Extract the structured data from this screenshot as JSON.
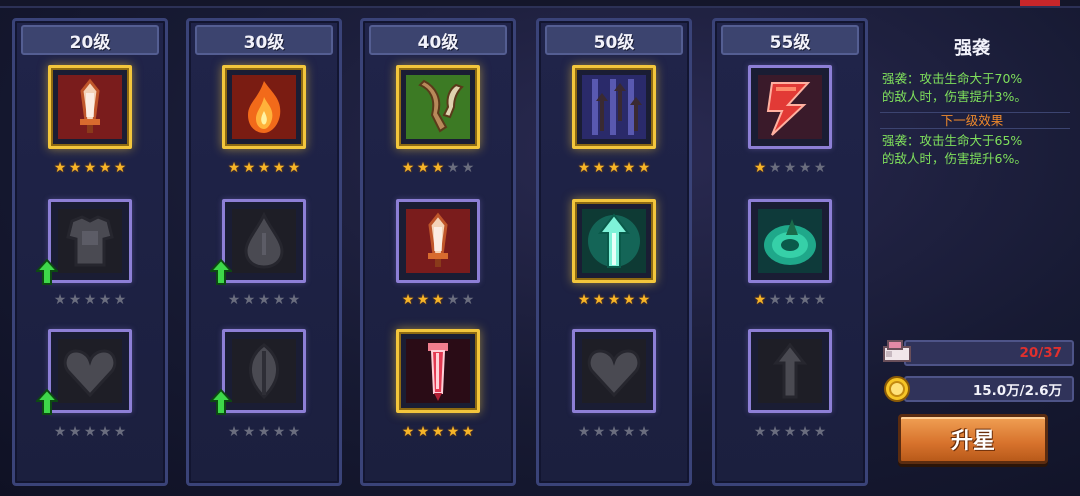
{
  "columns": [
    {
      "level": "20级",
      "slots": [
        {
          "icon": "sword-icon",
          "frame": "gold",
          "stars": 5,
          "upgrade": false
        },
        {
          "icon": "armor-icon",
          "frame": "purple",
          "stars": 0,
          "upgrade": true
        },
        {
          "icon": "heart-icon",
          "frame": "purple",
          "stars": 0,
          "upgrade": true
        }
      ]
    },
    {
      "level": "30级",
      "slots": [
        {
          "icon": "fire-icon",
          "frame": "gold",
          "stars": 5,
          "upgrade": false
        },
        {
          "icon": "drop-icon",
          "frame": "purple",
          "stars": 0,
          "upgrade": true
        },
        {
          "icon": "leaf-icon",
          "frame": "purple",
          "stars": 0,
          "upgrade": true
        }
      ]
    },
    {
      "level": "40级",
      "slots": [
        {
          "icon": "horn-icon",
          "frame": "gold",
          "stars": 3,
          "upgrade": false
        },
        {
          "icon": "sword-icon",
          "frame": "purple",
          "stars": 3,
          "upgrade": false
        },
        {
          "icon": "crystal-sword-icon",
          "frame": "gold",
          "stars": 5,
          "upgrade": false
        }
      ]
    },
    {
      "level": "50级",
      "slots": [
        {
          "icon": "arrows-icon",
          "frame": "gold",
          "stars": 5,
          "upgrade": false
        },
        {
          "icon": "glow-arrow-icon",
          "frame": "gold",
          "stars": 5,
          "upgrade": false
        },
        {
          "icon": "heart-icon",
          "frame": "purple",
          "stars": 0,
          "upgrade": false
        }
      ]
    },
    {
      "level": "55级",
      "slots": [
        {
          "icon": "lightning-icon",
          "frame": "purple",
          "stars": 1,
          "upgrade": false
        },
        {
          "icon": "vortex-icon",
          "frame": "purple",
          "stars": 1,
          "upgrade": false
        },
        {
          "icon": "arrow-icon",
          "frame": "purple",
          "stars": 0,
          "upgrade": false
        }
      ]
    }
  ],
  "info": {
    "title": "强袭",
    "current_line1": "强袭：攻击生命大于70%",
    "current_line2": "的敌人时，伤害提升3%。",
    "next_label": "下一级效果",
    "next_line1": "强袭：攻击生命大于65%",
    "next_line2": "的敌人时，伤害提升6%。"
  },
  "resources": {
    "fragments": "20/37",
    "gold": "15.0万/2.6万"
  },
  "upgrade_button": "升星",
  "colors": {
    "gold_frame": "#f3c63c",
    "purple_frame": "#8d7fd6",
    "effect_text": "#7fe05c",
    "next_label": "#f08a2c",
    "fragment_count": "#e0302e",
    "star_on": "#f6b428",
    "star_off": "#6a6d7e",
    "button": "#d7722c"
  }
}
